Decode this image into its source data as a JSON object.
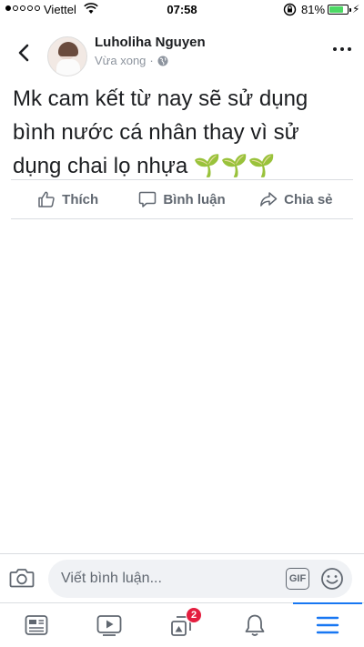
{
  "status_bar": {
    "carrier": "Viettel",
    "time": "07:58",
    "battery_percent": "81%",
    "battery_level": 0.81,
    "signal_bars": 1
  },
  "post": {
    "author": "Luholiha Nguyen",
    "timestamp": "Vừa xong",
    "separator": "·",
    "privacy_icon": "globe-icon",
    "text": "Mk cam kết từ nay sẽ sử dụng bình nước cá nhân thay vì sử dụng chai lọ nhựa",
    "emoji": "🌱🌱🌱"
  },
  "actions": {
    "like": "Thích",
    "comment": "Bình luận",
    "share": "Chia sẻ"
  },
  "comment_bar": {
    "placeholder": "Viết bình luận...",
    "gif_label": "GIF"
  },
  "bottom_nav": {
    "items": [
      {
        "icon": "news-feed-icon"
      },
      {
        "icon": "watch-icon"
      },
      {
        "icon": "groups-icon",
        "badge": "2"
      },
      {
        "icon": "notifications-icon"
      },
      {
        "icon": "menu-icon",
        "active": true
      }
    ]
  },
  "colors": {
    "accent": "#1877f2",
    "badge": "#e41e3f",
    "battery": "#4cd964",
    "sprout": "#36a420"
  }
}
